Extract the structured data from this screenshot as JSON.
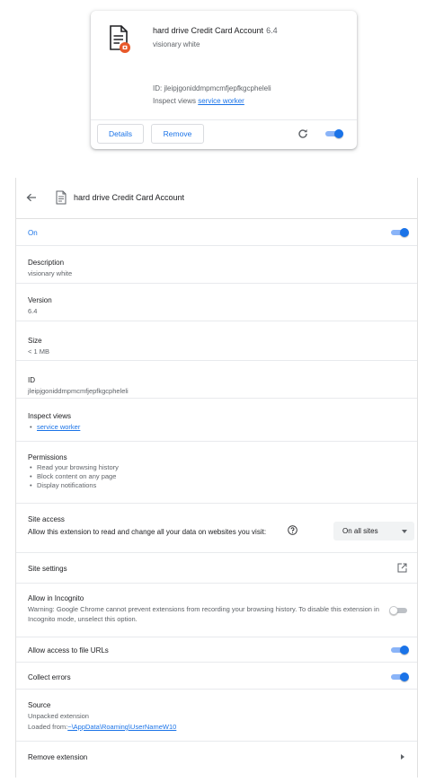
{
  "card": {
    "name": "hard drive Credit Card Account",
    "version": "6.4",
    "description": "visionary white",
    "id_text": "ID: jleipjgoniddmpmcmfjepfkgcpheleli",
    "inspect_prefix": "Inspect views",
    "inspect_link": "service worker",
    "details_label": "Details",
    "remove_label": "Remove",
    "enabled": true
  },
  "details": {
    "title": "hard drive Credit Card Account",
    "on_label": "On",
    "description_label": "Description",
    "description_value": "visionary white",
    "version_label": "Version",
    "version_value": "6.4",
    "size_label": "Size",
    "size_value": "< 1 MB",
    "id_label": "ID",
    "id_value": "jleipjgoniddmpmcmfjepfkgcpheleli",
    "inspect_label": "Inspect views",
    "inspect_link": "service worker",
    "permissions_label": "Permissions",
    "permissions": [
      "Read your browsing history",
      "Block content on any page",
      "Display notifications"
    ],
    "site_access_label": "Site access",
    "site_access_text": "Allow this extension to read and change all your data on websites you visit:",
    "site_access_select": "On all sites",
    "site_settings_label": "Site settings",
    "incognito_label": "Allow in Incognito",
    "incognito_warning": "Warning: Google Chrome cannot prevent extensions from recording your browsing history. To disable this extension in Incognito mode, unselect this option.",
    "incognito_enabled": false,
    "file_urls_label": "Allow access to file URLs",
    "file_urls_enabled": true,
    "collect_errors_label": "Collect errors",
    "collect_errors_enabled": true,
    "source_label": "Source",
    "source_value": "Unpacked extension",
    "loaded_from_prefix": "Loaded from:",
    "loaded_from_path": "~\\AppData\\Roaming\\UserNameW10",
    "remove_label": "Remove extension"
  },
  "colors": {
    "accent": "#1a73e8",
    "toggle_track": "#8ab4f8",
    "badge": "#e8592a"
  }
}
